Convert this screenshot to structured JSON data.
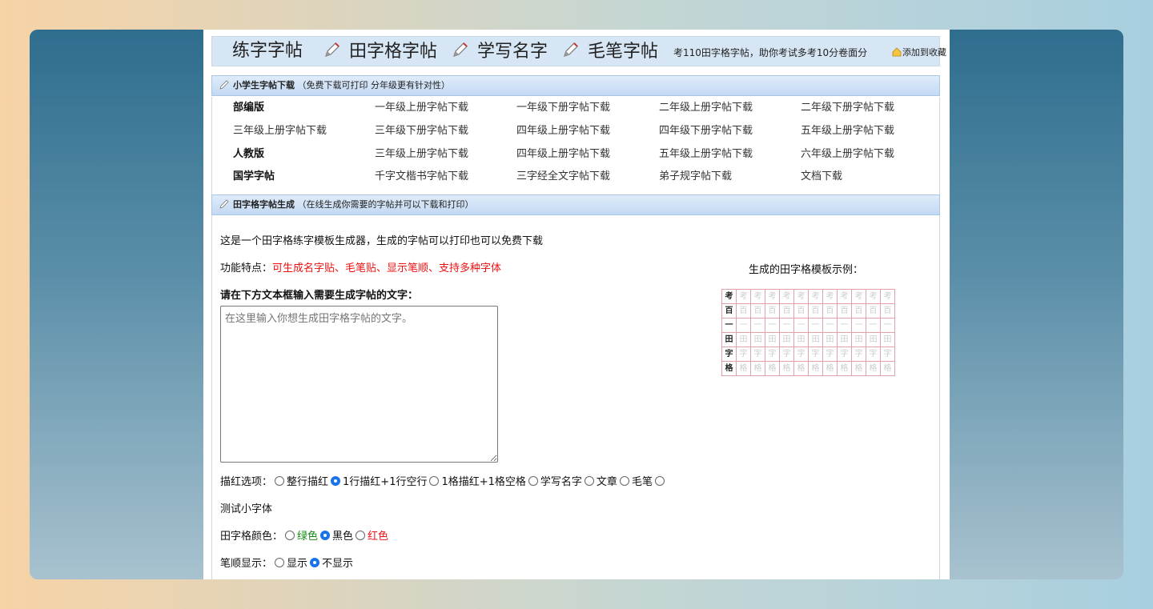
{
  "nav": {
    "items": [
      "练字字帖",
      "田字格字帖",
      "学写名字",
      "毛笔字帖"
    ],
    "tagline": "考110田字格字帖，助你考试多考10分卷面分",
    "favorite": "添加到收藏"
  },
  "section1": {
    "title": "小学生字帖下载",
    "subtitle": "（免费下载可打印 分年级更有针对性）"
  },
  "links": [
    [
      "部编版",
      "一年级上册字帖下载",
      "一年级下册字帖下载",
      "二年级上册字帖下载",
      "二年级下册字帖下载"
    ],
    [
      "三年级上册字帖下载",
      "三年级下册字帖下载",
      "四年级上册字帖下载",
      "四年级下册字帖下载",
      "五年级上册字帖下载"
    ],
    [
      "人教版",
      "三年级上册字帖下载",
      "四年级上册字帖下载",
      "五年级上册字帖下载",
      "六年级上册字帖下载"
    ],
    [
      "国学字帖",
      "千字文楷书字帖下载",
      "三字经全文字帖下载",
      "弟子规字帖下载",
      "文档下载"
    ]
  ],
  "section2": {
    "title": "田字格字帖生成",
    "subtitle": "（在线生成你需要的字帖并可以下载和打印）"
  },
  "content": {
    "intro": "这是一个田字格练字模板生成器，生成的字帖可以打印也可以免费下载",
    "features_label": "功能特点：",
    "features_value": "可生成名字贴、毛笔贴、显示笔顺、支持多种字体",
    "input_label": "请在下方文本框输入需要生成字帖的文字：",
    "textarea_placeholder": "在这里输入你想生成田字格字帖的文字。",
    "trace_label": "描红选项：",
    "trace_options": [
      "整行描红",
      "1行描红+1行空行",
      "1格描红+1格空格",
      "学写名字",
      "文章",
      "毛笔"
    ],
    "trace_selected": 1,
    "font_test": "测试小字体",
    "grid_color_label": "田字格颜色：",
    "grid_colors": [
      "绿色",
      "黑色",
      "红色"
    ],
    "grid_color_selected": 1,
    "stroke_label": "笔顺显示：",
    "stroke_options": [
      "显示",
      "不显示"
    ],
    "stroke_selected": 1,
    "sample_title": "生成的田字格模板示例：",
    "sample_chars": [
      "考",
      "百",
      "一",
      "田",
      "字",
      "格"
    ]
  },
  "colors": {
    "nav_bg": "#d7e6f5",
    "header_bg": "#c3d9f2",
    "accent_red": "#ee1111",
    "accent_green": "#108810",
    "grid_line": "#e2a0a8"
  }
}
